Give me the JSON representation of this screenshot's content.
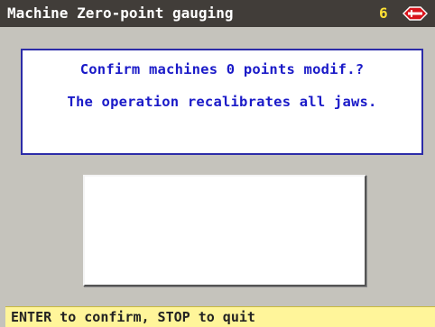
{
  "header": {
    "title": "Machine Zero-point gauging",
    "number": "6",
    "logo_icon": "silca-logo-icon"
  },
  "message": {
    "line1": "Confirm machines 0 points modif.?",
    "line2": "The operation recalibrates all jaws."
  },
  "status": {
    "text": "ENTER to confirm, STOP to quit"
  },
  "colors": {
    "title_bar": "#413d39",
    "accent_number": "#ffe135",
    "logo_red": "#d8141c",
    "message_text": "#1a1ac8",
    "status_bar": "#fff59a",
    "background": "#c5c3bc"
  }
}
